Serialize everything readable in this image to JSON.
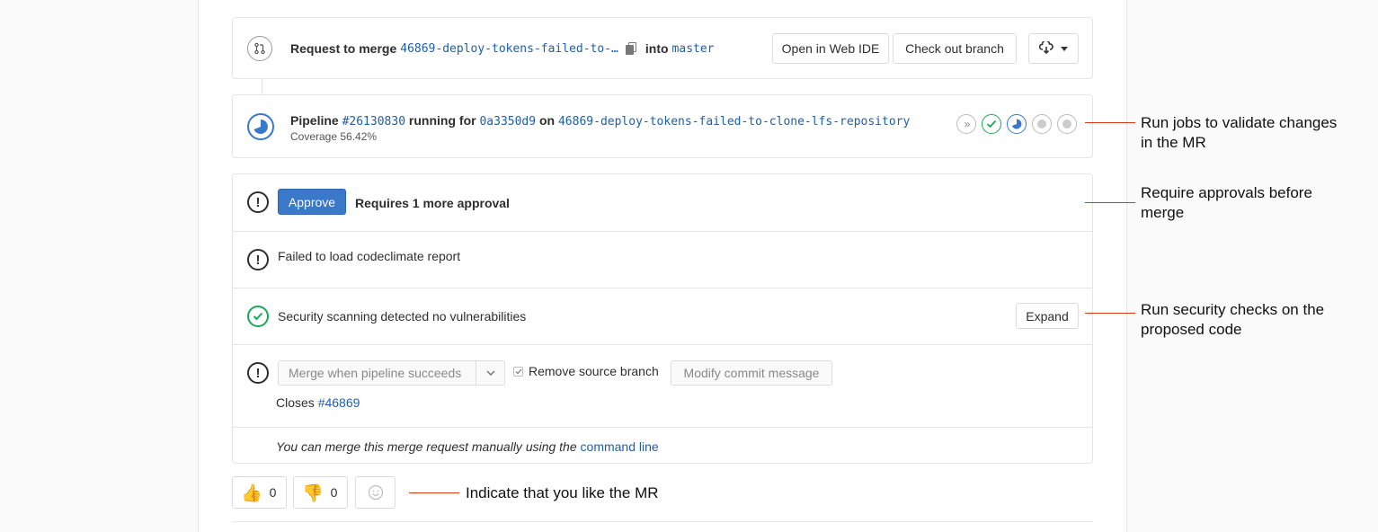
{
  "merge_header": {
    "prefix": "Request to merge",
    "source_branch": "46869-deploy-tokens-failed-to-…",
    "into": "into",
    "target_branch": "master",
    "open_web_ide": "Open in Web IDE",
    "check_out_branch": "Check out branch"
  },
  "pipeline": {
    "label": "Pipeline",
    "id": "#26130830",
    "status": "running for",
    "commit": "0a3350d9",
    "on": "on",
    "branch": "46869-deploy-tokens-failed-to-clone-lfs-repository",
    "coverage": "Coverage 56.42%"
  },
  "approval": {
    "button": "Approve",
    "text": "Requires 1 more approval"
  },
  "codeclimate": {
    "text": "Failed to load codeclimate report"
  },
  "security": {
    "text": "Security scanning detected no vulnerabilities",
    "expand": "Expand"
  },
  "merge": {
    "merge_button": "Merge when pipeline succeeds",
    "remove_source": "Remove source branch",
    "modify_commit": "Modify commit message",
    "closes_prefix": "Closes",
    "closes_issue": "#46869"
  },
  "manual": {
    "text": "You can merge this merge request manually using the",
    "link": "command line"
  },
  "reactions": {
    "thumbs_up_count": "0",
    "thumbs_down_count": "0"
  },
  "annotations": {
    "pipeline_line1": "Run jobs to validate changes",
    "pipeline_line2": "in the MR",
    "approval_line1": "Require approvals before",
    "approval_line2": "merge",
    "security_line1": "Run security checks on the",
    "security_line2": "proposed code",
    "reactions": "Indicate that you like the MR"
  },
  "colors": {
    "link": "#1f5fa6",
    "approve": "#3a78c9",
    "success": "#1aaa55",
    "annotation_line": "#d9351f"
  }
}
